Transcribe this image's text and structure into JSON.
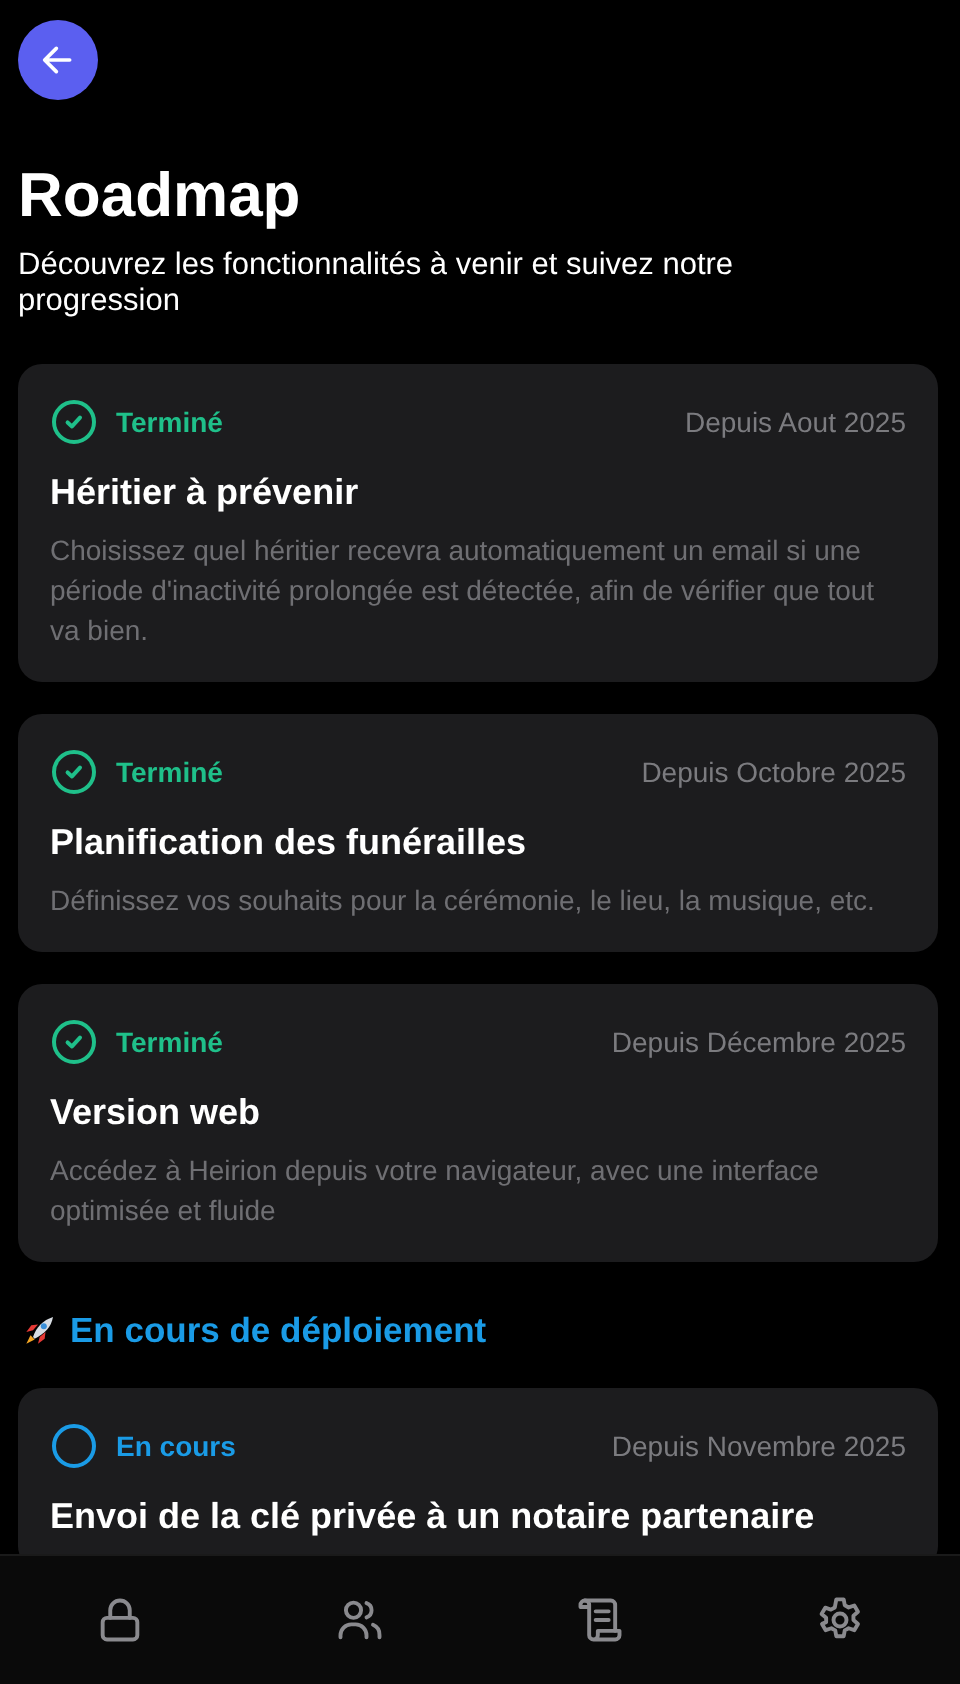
{
  "title": "Roadmap",
  "subtitle": "Découvrez les fonctionnalités à venir et suivez notre progression",
  "sections": [
    {
      "items": [
        {
          "status": "Terminé",
          "kind": "done",
          "date": "Depuis Aout 2025",
          "title": "Héritier à prévenir",
          "description": "Choisissez quel héritier recevra automatiquement un email si une période d'inactivité prolongée est détectée, afin de vérifier que tout va bien."
        },
        {
          "status": "Terminé",
          "kind": "done",
          "date": "Depuis Octobre 2025",
          "title": "Planification des funérailles",
          "description": "Définissez vos souhaits pour la cérémonie, le lieu, la musique, etc."
        },
        {
          "status": "Terminé",
          "kind": "done",
          "date": "Depuis Décembre 2025",
          "title": "Version web",
          "description": "Accédez à Heirion depuis votre navigateur, avec une interface optimisée et fluide"
        }
      ]
    },
    {
      "heading": "En cours de déploiement",
      "items": [
        {
          "status": "En cours",
          "kind": "in_progress",
          "date": "Depuis Novembre 2025",
          "title": "Envoi de la clé privée à un notaire partenaire"
        }
      ]
    }
  ],
  "nav": [
    {
      "kind": "lock"
    },
    {
      "kind": "users"
    },
    {
      "kind": "scroll"
    },
    {
      "kind": "settings"
    }
  ]
}
